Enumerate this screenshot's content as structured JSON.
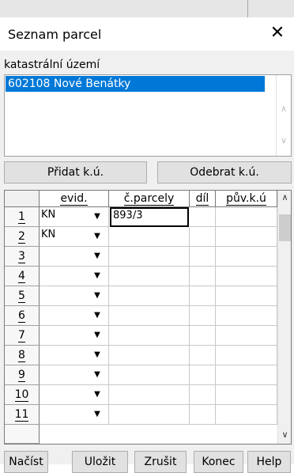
{
  "window": {
    "title": "Seznam parcel",
    "close_glyph": "✕"
  },
  "ku": {
    "label": "katastrální území",
    "items": [
      "602108 Nové Benátky"
    ],
    "scroll_up": "∧",
    "scroll_down": "∨"
  },
  "buttons": {
    "add_ku": "Přidat k.ú.",
    "remove_ku": "Odebrat k.ú."
  },
  "table": {
    "columns": [
      "evid.",
      "č.parcely",
      "díl",
      "pův.k.ú"
    ],
    "rows": [
      {
        "num": "1",
        "evid": "KN",
        "parcel": "893/3",
        "dil": "",
        "puv": ""
      },
      {
        "num": "2",
        "evid": "KN",
        "parcel": "",
        "dil": "",
        "puv": ""
      },
      {
        "num": "3",
        "evid": "",
        "parcel": "",
        "dil": "",
        "puv": ""
      },
      {
        "num": "4",
        "evid": "",
        "parcel": "",
        "dil": "",
        "puv": ""
      },
      {
        "num": "5",
        "evid": "",
        "parcel": "",
        "dil": "",
        "puv": ""
      },
      {
        "num": "6",
        "evid": "",
        "parcel": "",
        "dil": "",
        "puv": ""
      },
      {
        "num": "7",
        "evid": "",
        "parcel": "",
        "dil": "",
        "puv": ""
      },
      {
        "num": "8",
        "evid": "",
        "parcel": "",
        "dil": "",
        "puv": ""
      },
      {
        "num": "9",
        "evid": "",
        "parcel": "",
        "dil": "",
        "puv": ""
      },
      {
        "num": "10",
        "evid": "",
        "parcel": "",
        "dil": "",
        "puv": ""
      },
      {
        "num": "11",
        "evid": "",
        "parcel": "",
        "dil": "",
        "puv": ""
      }
    ],
    "dropdown_glyph": "▼",
    "scroll_up": "∧",
    "scroll_down": "∨"
  },
  "footer": {
    "load": "Načíst",
    "save": "Uložit",
    "cancel": "Zrušit",
    "end": "Konec",
    "help": "Help"
  },
  "colors": {
    "selection": "#0078d7",
    "background": "#f0f0f0"
  }
}
